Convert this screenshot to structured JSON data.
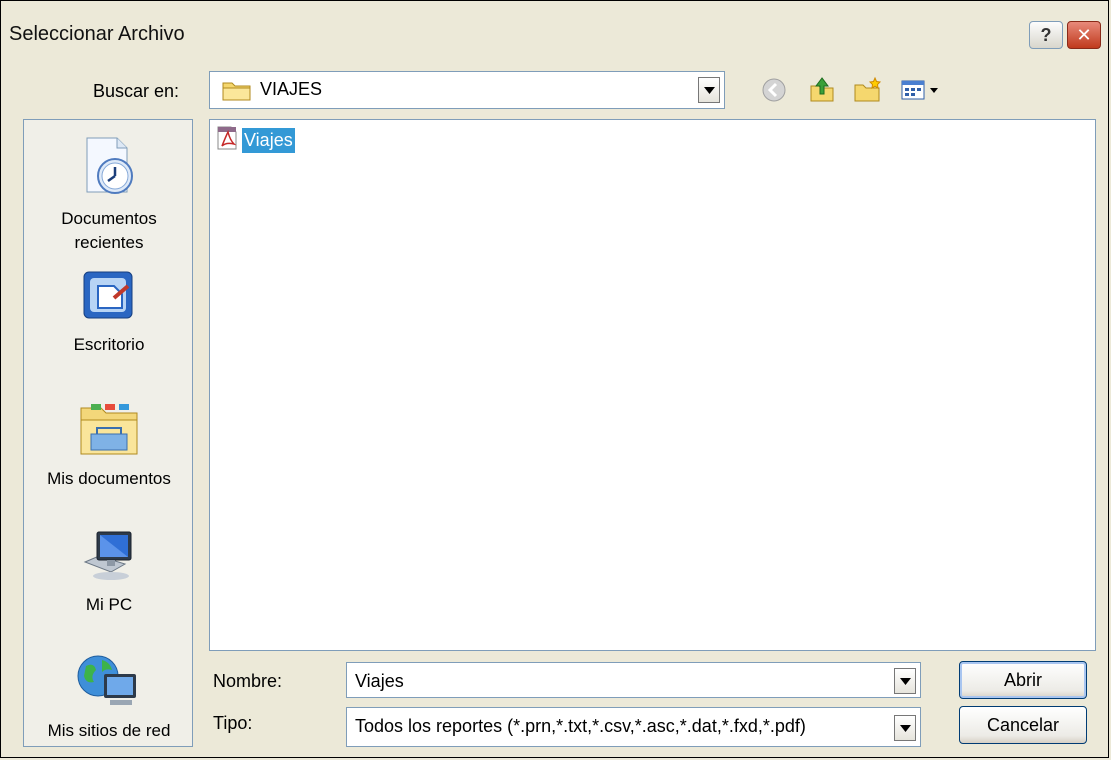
{
  "window": {
    "title": "Seleccionar Archivo",
    "help_label": "?",
    "close_label": "✕"
  },
  "lookin": {
    "label": "Buscar en:",
    "value": "VIAJES"
  },
  "toolbar": {
    "icons": [
      "back-icon",
      "up-folder-icon",
      "new-folder-icon",
      "view-menu-icon"
    ]
  },
  "places": [
    {
      "label": "Documentos\nrecientes",
      "icon": "recent-documents-icon"
    },
    {
      "label": "Escritorio",
      "icon": "desktop-icon"
    },
    {
      "label": "Mis documentos",
      "icon": "my-documents-icon"
    },
    {
      "label": "Mi PC",
      "icon": "my-computer-icon"
    },
    {
      "label": "Mis sitios de red",
      "icon": "network-places-icon"
    }
  ],
  "files": [
    {
      "name": "Viajes",
      "icon": "pdf-file-icon",
      "selected": true
    }
  ],
  "filename": {
    "label": "Nombre:",
    "value": "Viajes"
  },
  "filetype": {
    "label": "Tipo:",
    "value": "Todos los reportes (*.prn,*.txt,*.csv,*.asc,*.dat,*.fxd,*.pdf)"
  },
  "buttons": {
    "open": "Abrir",
    "cancel": "Cancelar"
  },
  "colors": {
    "selection": "#3399d6",
    "dialog_bg": "#ece9d8",
    "border": "#7f9db9"
  }
}
